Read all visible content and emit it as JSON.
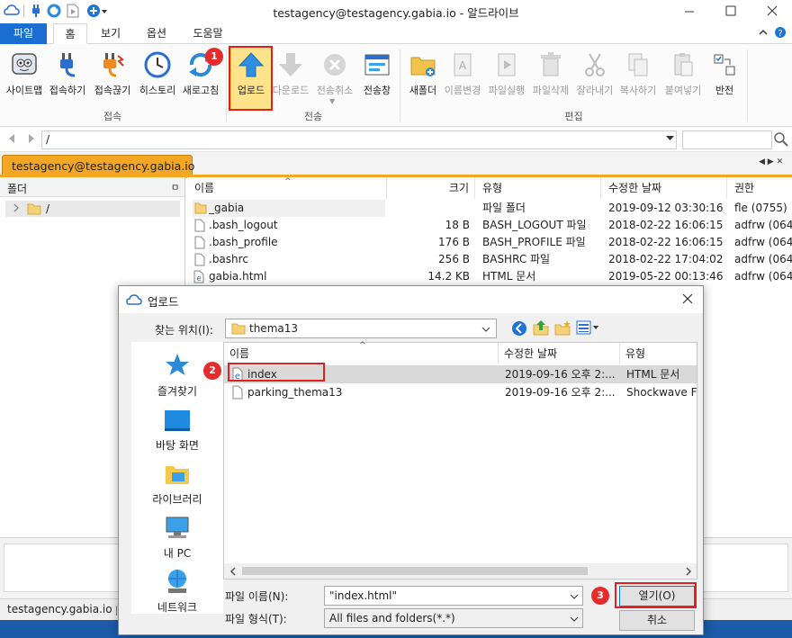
{
  "window": {
    "title": "testagency@testagency.gabia.io - 알드라이브"
  },
  "ribbon_tabs": [
    "파일",
    "홈",
    "보기",
    "옵션",
    "도움말"
  ],
  "ribbon": {
    "connect_buttons": [
      "사이트맵",
      "접속하기",
      "접속끊기",
      "히스토리",
      "새로고침"
    ],
    "transfer_buttons": [
      "업로드",
      "다운로드",
      "전송취소",
      "전송창"
    ],
    "edit_buttons": [
      "새폴더",
      "이름변경",
      "파일실행",
      "파일삭제",
      "잘라내기",
      "복사하기",
      "붙여넣기",
      "반전"
    ],
    "groups": {
      "connect": "접속",
      "transfer": "전송",
      "edit": "편집"
    }
  },
  "address": {
    "path": "/"
  },
  "session_tab": "testagency@testagency.gabia.io",
  "folder_pane": {
    "title": "폴더",
    "pin": "ㅁ",
    "root": "/"
  },
  "file_list": {
    "columns": [
      "이름",
      "크기",
      "유형",
      "수정한 날짜",
      "권한"
    ],
    "rows": [
      {
        "name": "_gabia",
        "size": "",
        "type": "파일 폴더",
        "date": "2019-09-12 03:30:16",
        "perm": "fle (0755)"
      },
      {
        "name": ".bash_logout",
        "size": "18 B",
        "type": "BASH_LOGOUT 파일",
        "date": "2018-02-22 16:06:15",
        "perm": "adfrw (064"
      },
      {
        "name": ".bash_profile",
        "size": "176 B",
        "type": "BASH_PROFILE 파일",
        "date": "2018-02-22 16:06:15",
        "perm": "adfrw (064"
      },
      {
        "name": ".bashrc",
        "size": "256 B",
        "type": "BASHRC 파일",
        "date": "2018-02-22 17:04:02",
        "perm": "adfrw (064"
      },
      {
        "name": "gabia.html",
        "size": "14.2 KB",
        "type": "HTML 문서",
        "date": "2019-05-22 00:13:46",
        "perm": "adfrw (064"
      }
    ]
  },
  "status": {
    "host": "testagency.gabia.io",
    "extra": "ㅣ"
  },
  "dialog": {
    "title": "업로드",
    "look_in_label": "찾는 위치(I):",
    "look_in_value": "thema13",
    "places": [
      "즐겨찾기",
      "바탕 화면",
      "라이브러리",
      "내 PC",
      "네트워크"
    ],
    "columns": [
      "이름",
      "수정한 날짜",
      "유형"
    ],
    "files": [
      {
        "name": "index",
        "date": "2019-09-16 오후 2:...",
        "type": "HTML 문서"
      },
      {
        "name": "parking_thema13",
        "date": "2019-09-16 오후 2:...",
        "type": "Shockwave Fla"
      }
    ],
    "filename_label": "파일 이름(N):",
    "filename_value": "\"index.html\"",
    "filetype_label": "파일 형식(T):",
    "filetype_value": "All files and folders(*.*)",
    "open_button": "열기(O)",
    "cancel_button": "취소"
  },
  "badges": [
    "1",
    "2",
    "3"
  ],
  "colors": {
    "accent": "#f5a623",
    "file_tab": "#1a6dd1",
    "badge": "#e52b2b",
    "highlight": "#ffe38a"
  }
}
